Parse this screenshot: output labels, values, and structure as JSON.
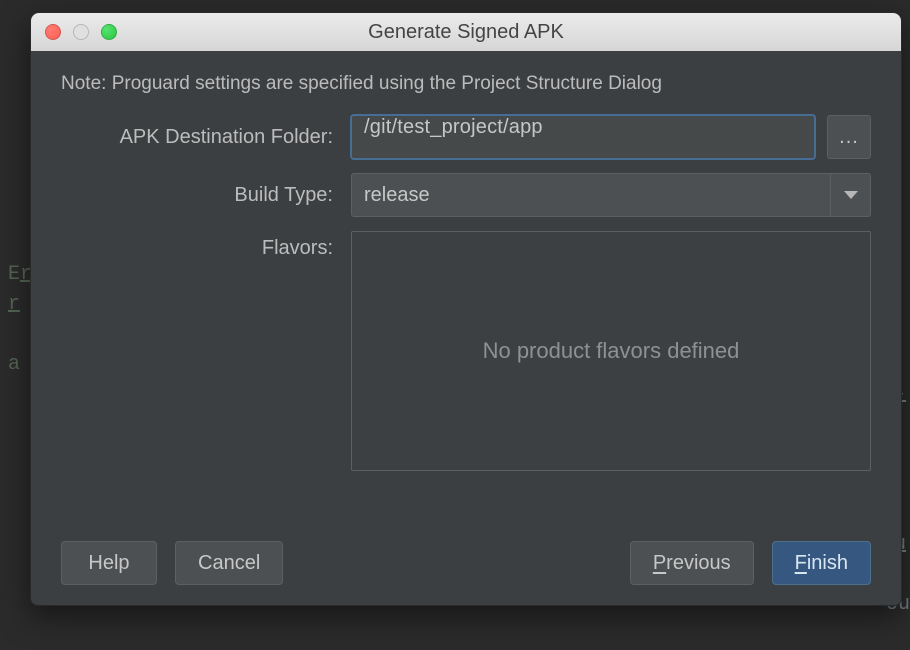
{
  "window": {
    "title": "Generate Signed APK"
  },
  "note": "Note: Proguard settings are specified using the Project Structure Dialog",
  "labels": {
    "destination": "APK Destination Folder:",
    "build_type": "Build Type:",
    "flavors": "Flavors:"
  },
  "fields": {
    "destination_value": "/git/test_project/app",
    "browse_label": "...",
    "build_type_value": "release",
    "flavors_empty": "No product flavors defined"
  },
  "buttons": {
    "help": "Help",
    "cancel": "Cancel",
    "previous_u": "P",
    "previous_rest": "revious",
    "finish_u": "F",
    "finish_rest": "inish"
  }
}
